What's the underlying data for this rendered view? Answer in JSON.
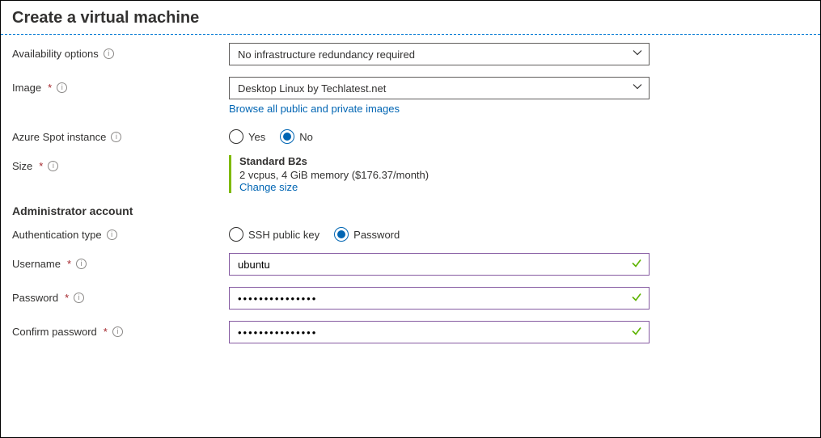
{
  "title": "Create a virtual machine",
  "availability": {
    "label": "Availability options",
    "value": "No infrastructure redundancy required"
  },
  "image": {
    "label": "Image",
    "value": "Desktop Linux by Techlatest.net",
    "browse_link": "Browse all public and private images"
  },
  "spot": {
    "label": "Azure Spot instance",
    "yes_label": "Yes",
    "no_label": "No",
    "selected": "No"
  },
  "size": {
    "label": "Size",
    "name": "Standard B2s",
    "desc": "2 vcpus, 4 GiB memory ($176.37/month)",
    "change_link": "Change size"
  },
  "admin": {
    "heading": "Administrator account",
    "auth": {
      "label": "Authentication type",
      "ssh_label": "SSH public key",
      "pwd_label": "Password",
      "selected": "Password"
    },
    "username": {
      "label": "Username",
      "value": "ubuntu"
    },
    "password": {
      "label": "Password",
      "value": "***************"
    },
    "confirm": {
      "label": "Confirm password",
      "value": "***************"
    }
  }
}
